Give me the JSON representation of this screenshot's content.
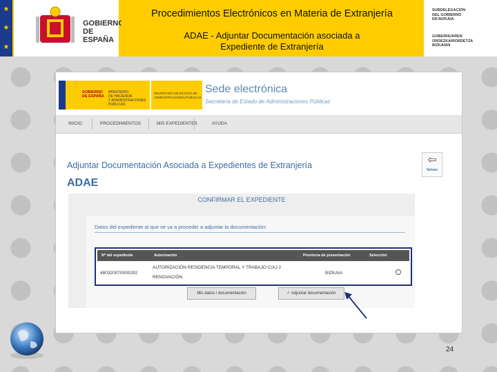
{
  "header": {
    "title": "Procedimientos Electrónicos en Materia de Extranjería",
    "subtitle": "ADAE - Adjuntar Documentación asociada a Expediente de Extranjería",
    "gov_logo_line1": "GOBIERNO",
    "gov_logo_line2": "DE ESPAÑA",
    "right_logo_line1": "SUBDELEGACIÓN",
    "right_logo_line2": "DEL GOBIERNO",
    "right_logo_line3": "EN BIZKAIA",
    "right_logo_line4": "GOBERNUAREN",
    "right_logo_line5": "ORDEZKARIORDETZA",
    "right_logo_line6": "BIZKAIAN"
  },
  "screenshot": {
    "mini_logo_line1": "GOBIERNO",
    "mini_logo_line2": "DE ESPAÑA",
    "mini_logo_ministry1": "MINISTERIO",
    "mini_logo_ministry2": "DE HACIENDA",
    "mini_logo_ministry3": "Y ADMINISTRACIONES PÚBLICAS",
    "mini_logo_right1": "SECRETARÍA DE ESTADO DE",
    "mini_logo_right2": "ADMINISTRACIONES PÚBLICAS",
    "sede_title": "Sede electrónica",
    "sede_subtitle": "Secretaría de Estado de Administraciones Públicas",
    "nav": [
      "INICIO",
      "PROCEDIMIENTOS",
      "MIS EXPEDIENTES",
      "AYUDA"
    ],
    "page_title": "Adjuntar Documentación Asociada a Expedientes de Extranjería",
    "section_title": "ADAE",
    "volver_label": "Volver",
    "confirm_title": "CONFIRMAR EL EXPEDIENTE",
    "inner_heading": "Datos del expediente al que se va a proceder a adjuntar la documentación:",
    "table": {
      "headers": [
        "Nº del expediente",
        "Autorización",
        "Provincia de presentación",
        "Selección"
      ],
      "row": {
        "expediente": "480320070000292",
        "autorizacion_line1": "AUTORIZACIÓN RESIDENCIA TEMPORAL Y TRABAJO C/AJ 2",
        "autorizacion_line2": "RENOVACIÓN",
        "provincia": "BIZKAIA"
      }
    },
    "buttons": {
      "mis_datos": "Mis datos / documentación",
      "adjuntar": "Adjuntar documentación"
    }
  },
  "page_number": "24",
  "colors": {
    "banner_yellow": "#ffcc00",
    "link_blue": "#3a6ea5",
    "highlight_border": "#1f2e7a"
  }
}
